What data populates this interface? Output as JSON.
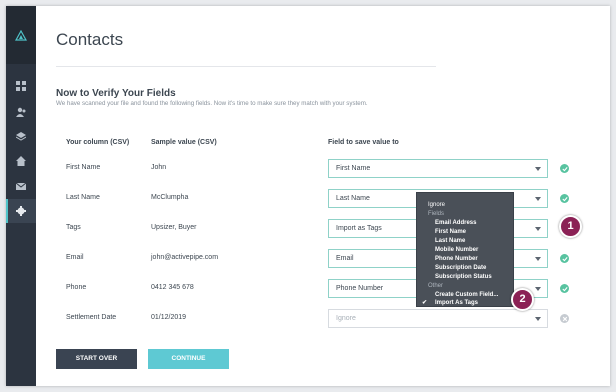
{
  "page": {
    "title": "Contacts",
    "section_title": "Now to Verify Your Fields",
    "section_desc": "We have scanned your file and found the following fields. Now it's time to make sure they match with your system."
  },
  "table": {
    "headers": [
      "Your column (CSV)",
      "Sample value (CSV)",
      "Field to save value to"
    ],
    "rows": [
      {
        "column": "First Name",
        "sample": "John",
        "field": "First Name",
        "status": "check"
      },
      {
        "column": "Last Name",
        "sample": "McClumpha",
        "field": "Last Name",
        "status": "check"
      },
      {
        "column": "Tags",
        "sample": "Upsizer, Buyer",
        "field": "Import as Tags",
        "status": "check"
      },
      {
        "column": "Email",
        "sample": "john@activepipe.com",
        "field": "Email",
        "status": "check"
      },
      {
        "column": "Phone",
        "sample": "0412 345 678",
        "field": "Phone Number",
        "status": "check"
      },
      {
        "column": "Settlement Date",
        "sample": "01/12/2019",
        "field": "Ignore",
        "status": "x"
      }
    ]
  },
  "dropdown": {
    "ignore": "Ignore",
    "group_fields": "Fields",
    "fields": [
      "Email Address",
      "First Name",
      "Last Name",
      "Mobile Number",
      "Phone Number",
      "Subscription Date",
      "Subscription Status"
    ],
    "group_other": "Other",
    "other": [
      "Create Custom Field...",
      "Import As Tags"
    ],
    "selected_index_other": 1
  },
  "buttons": {
    "start_over": "START OVER",
    "continue": "CONTINUE"
  },
  "badges": {
    "one": "1",
    "two": "2"
  },
  "colors": {
    "sidebar": "#2c3440",
    "teal": "#5ec9d3",
    "check": "#58c3a0",
    "badge": "#8b2155"
  }
}
